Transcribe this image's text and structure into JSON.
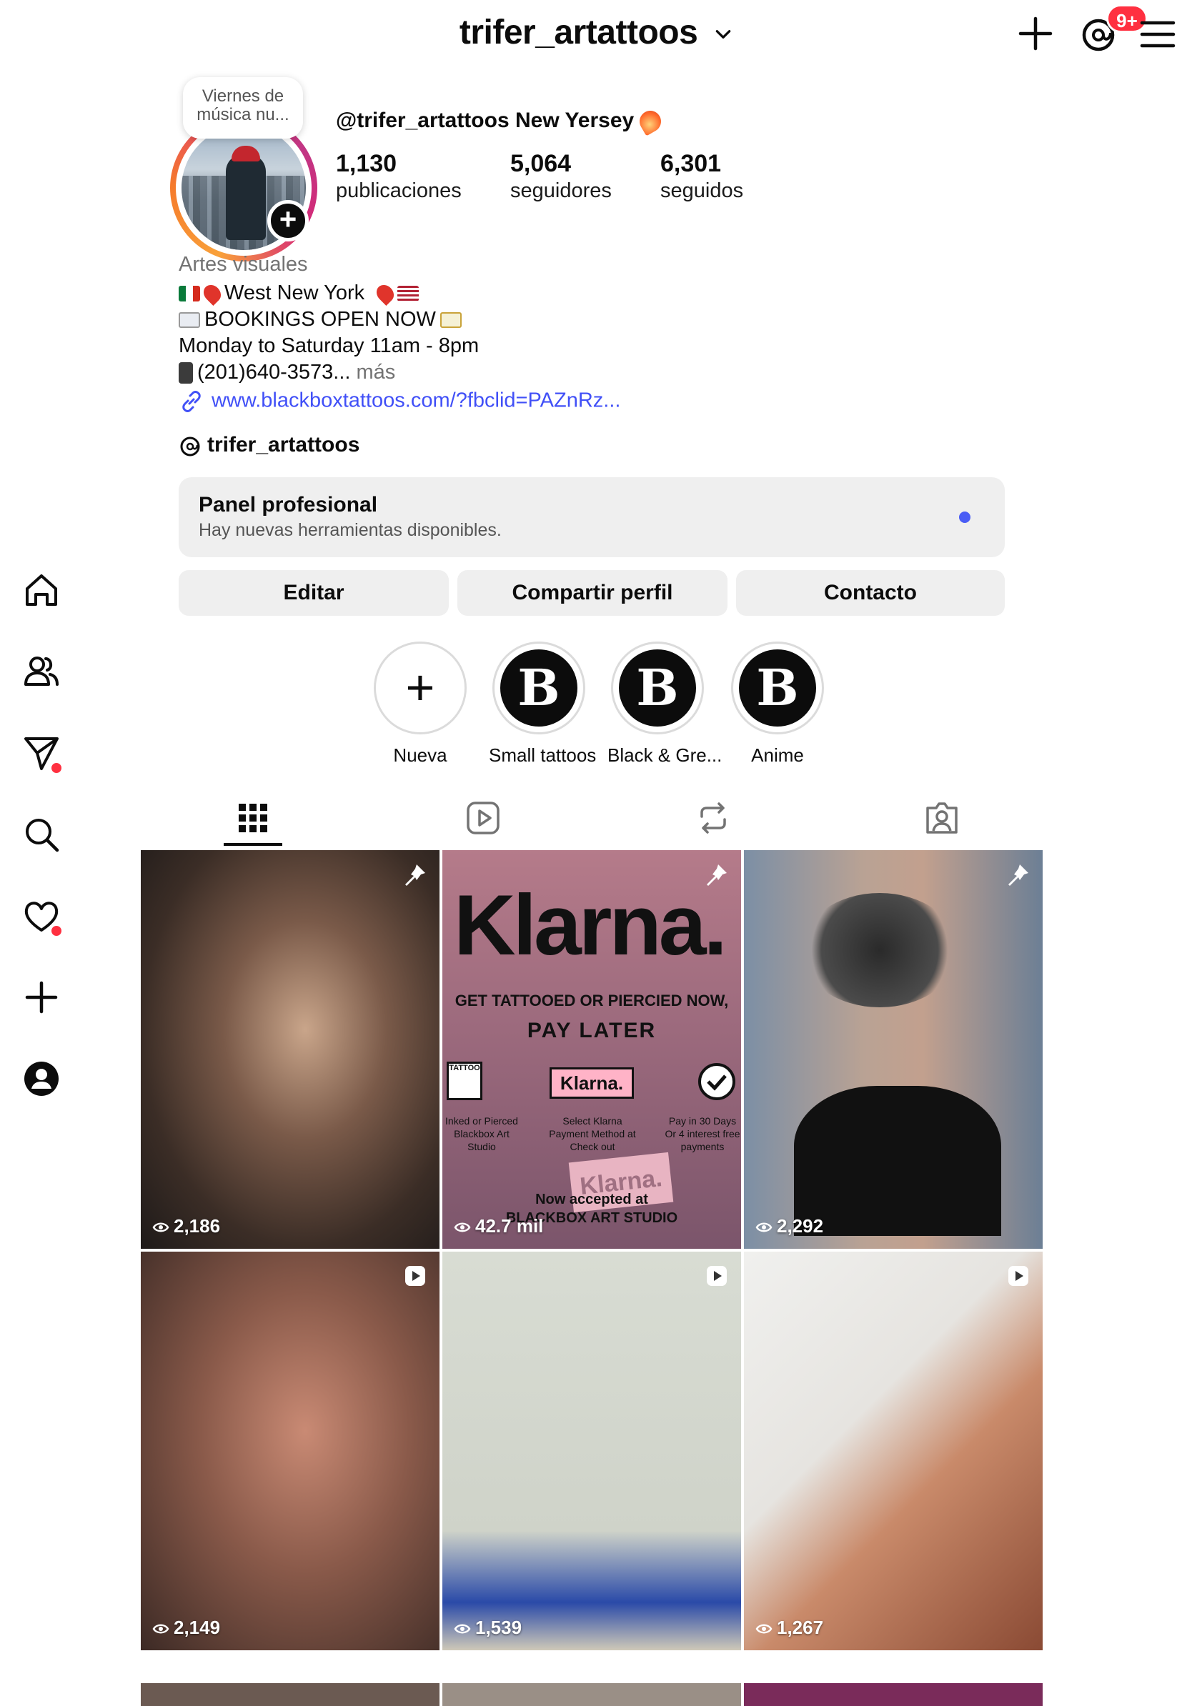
{
  "header": {
    "username": "trifer_artattoos",
    "notification_badge": "9+"
  },
  "nav": {
    "items": [
      "home",
      "people",
      "messages",
      "search",
      "notifications",
      "create",
      "profile"
    ]
  },
  "profile": {
    "note": "Viernes de música nu...",
    "display_line": "@trifer_artattoos New Yersey",
    "stats": [
      {
        "value": "1,130",
        "label": "publicaciones"
      },
      {
        "value": "5,064",
        "label": "seguidores"
      },
      {
        "value": "6,301",
        "label": "seguidos"
      }
    ],
    "category": "Artes visuales",
    "bio": {
      "line1": "West New York",
      "line2": "BOOKINGS OPEN NOW",
      "line3": " Monday to Saturday 11am - 8pm",
      "line4": "(201)640-3573...",
      "more": "más"
    },
    "link": "www.blackboxtattoos.com/?fbclid=PAZnRz...",
    "threads_handle": "trifer_artattoos"
  },
  "panel": {
    "title": "Panel profesional",
    "subtitle": "Hay nuevas herramientas disponibles."
  },
  "buttons": {
    "edit": "Editar",
    "share": "Compartir perfil",
    "contact": "Contacto"
  },
  "highlights": [
    {
      "label": "Nueva"
    },
    {
      "label": "Small tattoos"
    },
    {
      "label": "Black & Gre..."
    },
    {
      "label": "Anime"
    }
  ],
  "tabs": [
    "posts-grid",
    "reels",
    "reposts",
    "tagged"
  ],
  "posts": [
    {
      "views": "2,186",
      "type": "pinned"
    },
    {
      "views": "42.7 mil",
      "type": "pinned"
    },
    {
      "views": "2,292",
      "type": "pinned"
    },
    {
      "views": "2,149",
      "type": "reel"
    },
    {
      "views": "1,539",
      "type": "reel"
    },
    {
      "views": "1,267",
      "type": "reel"
    }
  ],
  "klarna_post": {
    "brand": "Klarna.",
    "line1": "GET TATTOOED OR PIERCIED NOW,",
    "line2": "PAY LATER",
    "tattoo_label": "TATTOO",
    "box": "Klarna.",
    "step1": "Inked or Pierced Blackbox Art Studio",
    "step2": "Select Klarna Payment Method at Check out",
    "step3": "Pay in 30 Days Or 4 interest free payments",
    "card": "Klarna.",
    "footer1": "Now accepted at",
    "footer2": "BLACKBOX ART STUDIO"
  },
  "colors": {
    "accent_link": "#4150f7",
    "badge_red": "#ff3040",
    "panel_bg": "#efefef"
  }
}
